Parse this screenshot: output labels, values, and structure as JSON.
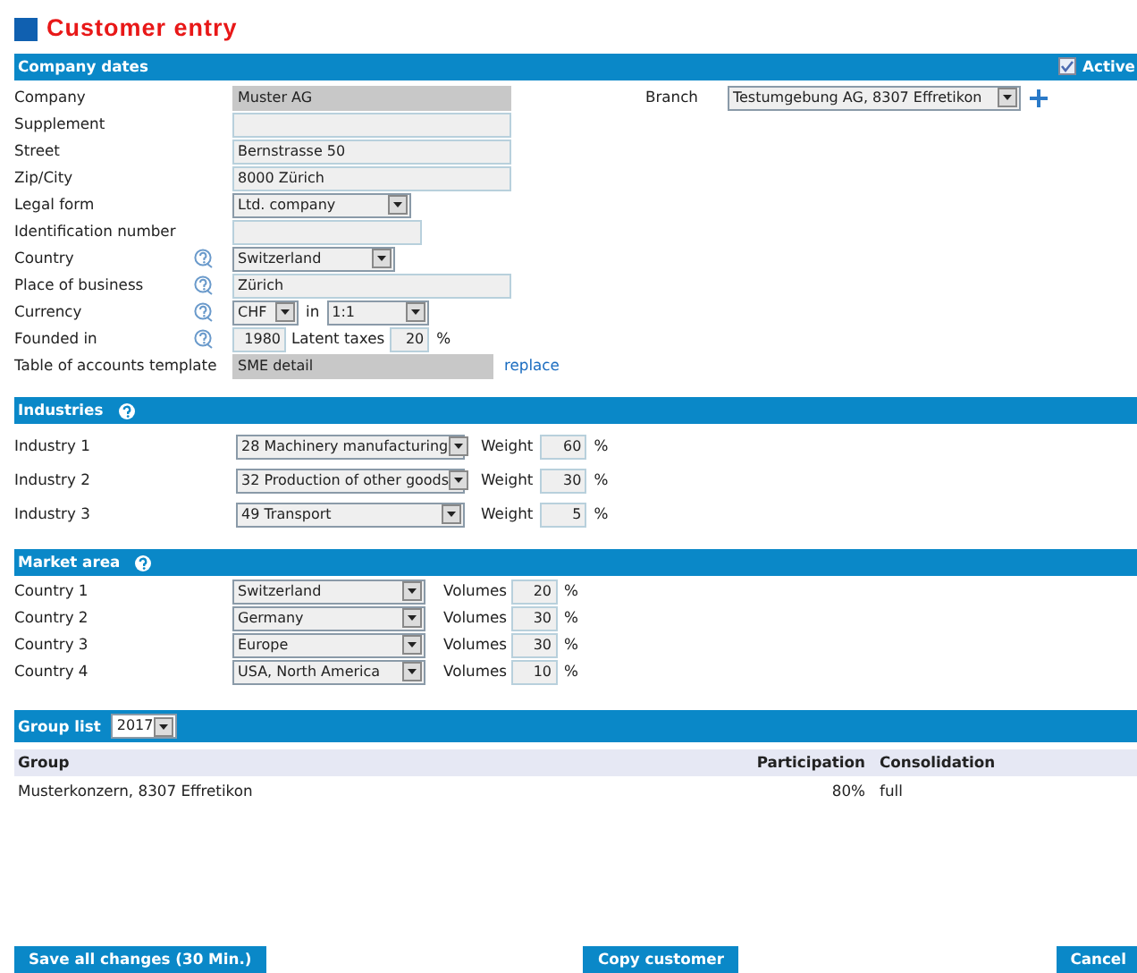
{
  "title": "Customer entry",
  "company": {
    "title": "Company dates",
    "active": {
      "label": "Active",
      "checked": true
    },
    "branch": {
      "label": "Branch",
      "value": "Testumgebung AG, 8307 Effretikon"
    },
    "fields": [
      {
        "label": "Company",
        "kind": "readonly",
        "value": "Muster AG",
        "help": false
      },
      {
        "label": "Supplement",
        "kind": "text",
        "help": false
      },
      {
        "label": "Street",
        "kind": "text",
        "value": "Bernstrasse 50",
        "help": false
      },
      {
        "label": "Zip/City",
        "kind": "text",
        "value": "8000 Zürich",
        "help": false
      },
      {
        "label": "Legal form",
        "kind": "select",
        "value": "Ltd. company",
        "help": false
      },
      {
        "label": "Identification number",
        "kind": "text",
        "help": false
      },
      {
        "label": "Country",
        "kind": "select",
        "value": "Switzerland",
        "help": true
      },
      {
        "label": "Place of business",
        "kind": "text",
        "value": "Zürich",
        "help": true
      },
      {
        "label": "Currency",
        "kind": "currency",
        "value": "CHF",
        "in_label": "in",
        "rate": "1:1",
        "help": true
      },
      {
        "label": "Founded in",
        "kind": "founded",
        "value": "1980",
        "taxes_label": "Latent taxes",
        "taxes": "20",
        "unit": "%",
        "help": true
      },
      {
        "label": "Table of accounts template",
        "kind": "template",
        "value": "SME detail",
        "link": "replace",
        "help": false
      }
    ]
  },
  "industries": {
    "title": "Industries",
    "rows": [
      {
        "label": "Industry 1",
        "value": "28 Machinery manufacturing",
        "weight_label": "Weight",
        "weight": "60",
        "unit": "%"
      },
      {
        "label": "Industry 2",
        "value": "32 Production of other goods",
        "weight_label": "Weight",
        "weight": "30",
        "unit": "%"
      },
      {
        "label": "Industry 3",
        "value": "49 Transport",
        "weight_label": "Weight",
        "weight": "5",
        "unit": "%"
      }
    ]
  },
  "market": {
    "title": "Market area",
    "rows": [
      {
        "label": "Country 1",
        "value": "Switzerland",
        "volumes_label": "Volumes",
        "volume": "20",
        "unit": "%"
      },
      {
        "label": "Country 2",
        "value": "Germany",
        "volumes_label": "Volumes",
        "volume": "30",
        "unit": "%"
      },
      {
        "label": "Country 3",
        "value": "Europe",
        "volumes_label": "Volumes",
        "volume": "30",
        "unit": "%"
      },
      {
        "label": "Country 4",
        "value": "USA, North America",
        "volumes_label": "Volumes",
        "volume": "10",
        "unit": "%"
      }
    ]
  },
  "group_list": {
    "title": "Group list",
    "year": "2017",
    "columns": [
      "Group",
      "Participation",
      "Consolidation"
    ],
    "rows": [
      [
        "Musterkonzern, 8307 Effretikon",
        "80%",
        "full"
      ]
    ]
  },
  "buttons": [
    "Save all changes (30 Min.)",
    "Copy customer",
    "Cancel"
  ]
}
